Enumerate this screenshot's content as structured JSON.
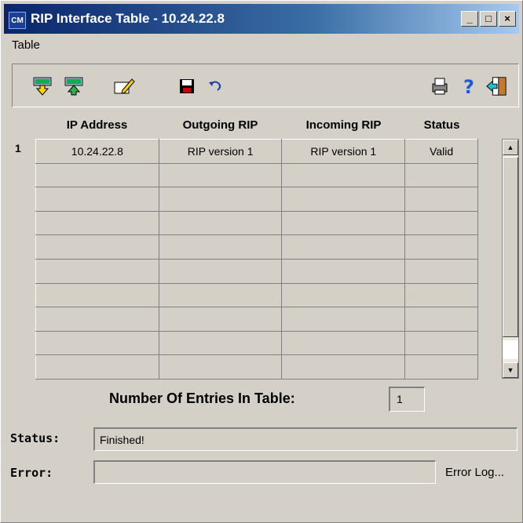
{
  "window": {
    "title": "RIP Interface Table - 10.24.22.8",
    "app_icon_text": "CM",
    "minimize_glyph": "_",
    "maximize_glyph": "□",
    "close_glyph": "×"
  },
  "menu": {
    "items": [
      "Table"
    ]
  },
  "toolbar": {
    "icons": [
      "download-icon",
      "upload-icon",
      "edit-icon",
      "save-icon",
      "undo-icon",
      "print-icon",
      "help-icon",
      "exit-icon"
    ]
  },
  "table": {
    "columns": [
      "IP Address",
      "Outgoing RIP",
      "Incoming RIP",
      "Status"
    ],
    "rows": [
      {
        "index": "1",
        "ip": "10.24.22.8",
        "outgoing": "RIP version 1",
        "incoming": "RIP version 1",
        "status": "Valid"
      }
    ],
    "empty_rows": 9
  },
  "entries": {
    "label": "Number Of Entries In Table:",
    "value": "1"
  },
  "status": {
    "label": "Status:",
    "value": "Finished!"
  },
  "error": {
    "label": "Error:",
    "value": "",
    "log_link": "Error Log..."
  },
  "colors": {
    "title_start": "#0a246a",
    "title_end": "#a6caf0",
    "face": "#d4d0c8"
  }
}
